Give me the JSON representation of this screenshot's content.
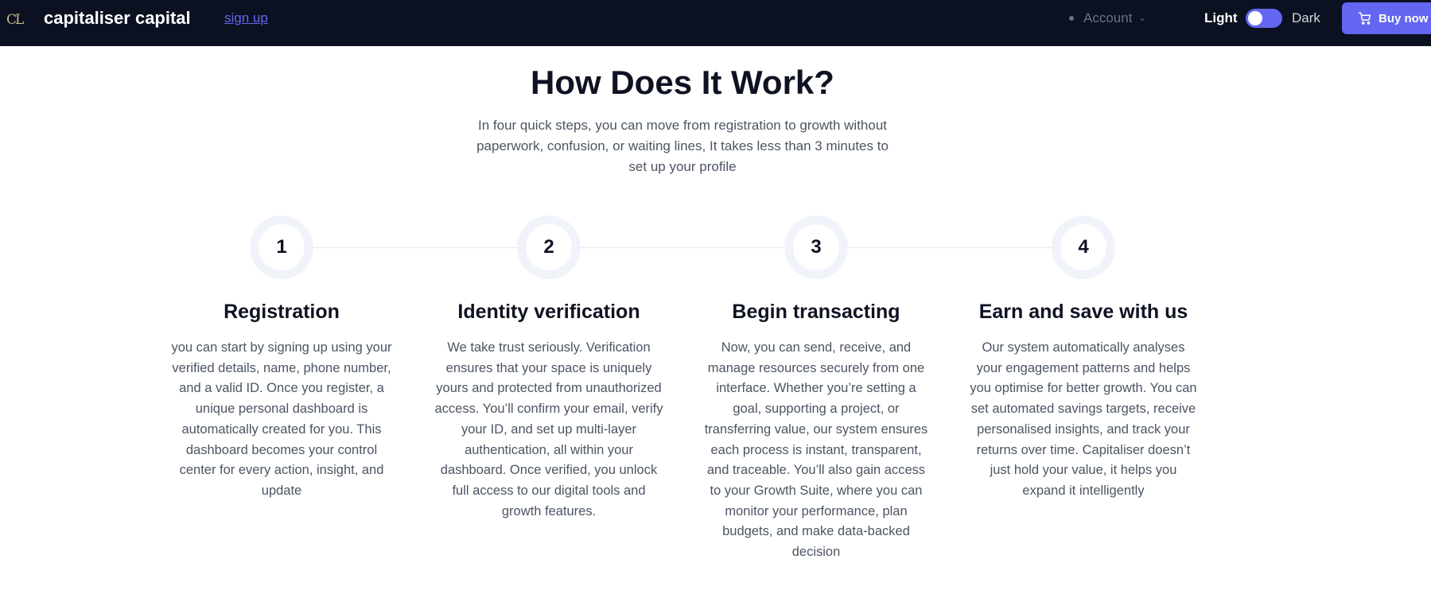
{
  "nav": {
    "logo_text": "CL",
    "brand": "capitaliser capital",
    "signup": "sign up",
    "account": "Account",
    "theme_light": "Light",
    "theme_dark": "Dark",
    "buy_now": "Buy now",
    "toggle_state": "light"
  },
  "colors": {
    "nav_bg": "#0b1120",
    "accent": "#6366f1",
    "heading": "#0f1222",
    "body_text": "#4b5563"
  },
  "section": {
    "title": "How Does It Work?",
    "subtitle": "In four quick steps, you can move from registration to growth without paperwork, confusion, or waiting lines, It takes less than 3 minutes to set up your profile"
  },
  "steps": [
    {
      "number": "1",
      "title": "Registration",
      "body": "you can start by signing up using your verified details, name, phone number, and a valid ID. Once you register, a unique personal dashboard is automatically created for you. This dashboard becomes your control center for every action, insight, and update"
    },
    {
      "number": "2",
      "title": "Identity verification",
      "body": "We take trust seriously. Verification ensures that your space is uniquely yours and protected from unauthorized access. You’ll confirm your email, verify your ID, and set up multi-layer authentication, all within your dashboard. Once verified, you unlock full access to our digital tools and growth features."
    },
    {
      "number": "3",
      "title": "Begin transacting",
      "body": "Now, you can send, receive, and manage resources securely from one interface. Whether you’re setting a goal, supporting a project, or transferring value, our system ensures each process is instant, transparent, and traceable. You’ll also gain access to your Growth Suite, where you can monitor your performance, plan budgets, and make data-backed decision"
    },
    {
      "number": "4",
      "title": "Earn and save with us",
      "body": "Our system automatically analyses your engagement patterns and helps you optimise for better growth. You can set automated savings targets, receive personalised insights, and track your returns over time. Capitaliser doesn’t just hold your value, it helps you expand it intelligently"
    }
  ]
}
